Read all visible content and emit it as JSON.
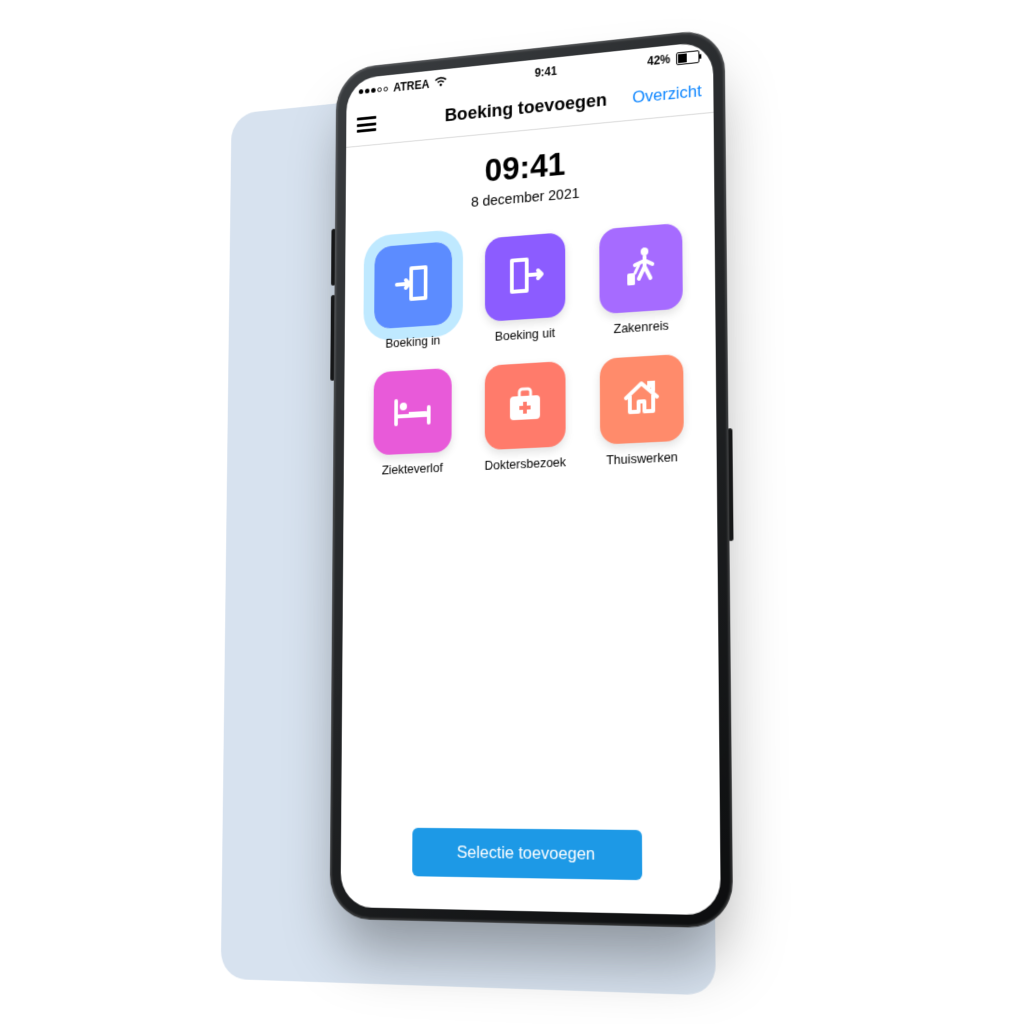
{
  "statusbar": {
    "carrier": "ATREA",
    "time": "9:41",
    "battery_pct": "42%"
  },
  "header": {
    "title": "Boeking toevoegen",
    "right_action": "Overzicht"
  },
  "main": {
    "time": "09:41",
    "date": "8 december 2021"
  },
  "tiles": {
    "boeking_in": {
      "label": "Boeking in",
      "color": "#5c8cff",
      "selected": true
    },
    "boeking_uit": {
      "label": "Boeking uit",
      "color": "#8c5cff",
      "selected": false
    },
    "zakenreis": {
      "label": "Zakenreis",
      "color": "#a66bff",
      "selected": false
    },
    "ziekteverlof": {
      "label": "Ziekteverlof",
      "color": "#e85ad9",
      "selected": false
    },
    "doktersbezoek": {
      "label": "Doktersbezoek",
      "color": "#ff7b6b",
      "selected": false
    },
    "thuiswerken": {
      "label": "Thuiswerken",
      "color": "#ff8b6b",
      "selected": false
    }
  },
  "cta": {
    "label": "Selectie toevoegen"
  },
  "colors": {
    "accent_link": "#0a84ff",
    "cta_bg": "#1d99e6",
    "highlight_ring": "#bfe9ff"
  }
}
